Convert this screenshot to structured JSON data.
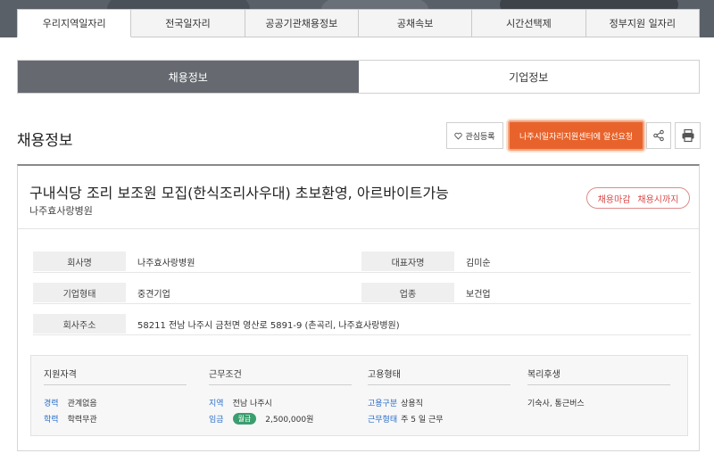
{
  "top_nav": [
    "우리지역일자리",
    "전국일자리",
    "공공기관채용정보",
    "공채속보",
    "시간선택제",
    "정부지원 일자리"
  ],
  "big_tabs": [
    "채용정보",
    "기업정보"
  ],
  "section": {
    "title": "채용정보",
    "fav_label": "관심등록",
    "request_label": "나주시일자리지원센터에 알선요청"
  },
  "job": {
    "title": "구내식당 조리 보조원 모집(한식조리사우대) 초보환영, 아르바이트가능",
    "company": "나주효사랑병원",
    "status": "채용마감",
    "deadline": "채용시까지"
  },
  "company_info": {
    "name_label": "회사명",
    "name": "나주효사랑병원",
    "ceo_label": "대표자명",
    "ceo": "김미순",
    "type_label": "기업형태",
    "type": "중견기업",
    "industry_label": "업종",
    "industry": "보건업",
    "address_label": "회사주소",
    "address": "58211 전남 나주시 금천면 영산로 5891-9 (촌곡리, 나주효사랑병원)"
  },
  "conditions": {
    "qual_title": "지원자격",
    "career_key": "경력",
    "career_val": "관계없음",
    "edu_key": "학력",
    "edu_val": "학력무관",
    "work_title": "근무조건",
    "region_key": "지역",
    "region_val": "전남 나주시",
    "wage_key": "임금",
    "wage_type": "월급",
    "wage_val": "2,500,000원",
    "emp_title": "고용형태",
    "emp_key": "고용구분",
    "emp_val": "상용직",
    "shift_key": "근무형태",
    "shift_val": "주 5 일 근무",
    "welfare_title": "복리후생",
    "welfare_val": "기숙사, 통근버스"
  },
  "colors": {
    "accent": "#e8632b",
    "active_tab": "#666a70",
    "link_key": "#2a6fc9",
    "wage_pill": "#3b9e6e",
    "deadline": "#d94848"
  },
  "icons": [
    "heart-icon",
    "share-icon",
    "print-icon"
  ]
}
